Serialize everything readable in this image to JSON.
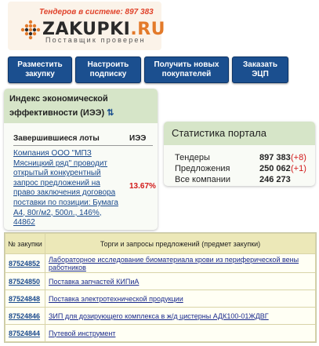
{
  "header": {
    "tenders_line": "Тендеров в системе: 897 383",
    "logo_main": "ZAKUPKI",
    "logo_tld": ".RU",
    "tagline": "Поставщик проверен"
  },
  "nav": {
    "btn1_line1": "Разместить",
    "btn1_line2": "закупку",
    "btn2_line1": "Настроить",
    "btn2_line2": "подписку",
    "btn3_line1": "Получить новых",
    "btn3_line2": "покупателей",
    "btn4_line1": "Заказать",
    "btn4_line2": "ЭЦП"
  },
  "iee": {
    "title": "Индекс экономической эффективности (ИЭЭ)",
    "col_lots": "Завершившиеся лоты",
    "col_iee": "ИЭЭ",
    "lot_text": "Компания ООО \"МПЗ Мясницкий ряд\" проводит открытый конкурентный запрос предложений на право заключения договора поставки по позиции: Бумага А4, 80г/м2, 500л., 146%, 44862",
    "lot_value": "13.67%"
  },
  "stats": {
    "title": "Статистика портала",
    "tenders_label": "Тендеры",
    "tenders_value": "897 383",
    "tenders_delta": "(+8)",
    "offers_label": "Предложения",
    "offers_value": "250 062",
    "offers_delta": "(+1)",
    "companies_label": "Все компании",
    "companies_value": "246 273"
  },
  "table": {
    "col_num": "№ закупки",
    "col_subject": "Торги и запросы предложений (предмет закупки)",
    "rows": [
      {
        "num": "87524852",
        "subject": "Лабораторное исследование биоматериала крови из периферической вены работников"
      },
      {
        "num": "87524850",
        "subject": "Поставка запчастей КИПиА"
      },
      {
        "num": "87524848",
        "subject": "Поставка электротехнической продукции"
      },
      {
        "num": "87524846",
        "subject": "ЗИП для дозирующего комплекса в ж/д цистерны АДК100-01ЖДВГ"
      },
      {
        "num": "87524844",
        "subject": "Путевой инструмент"
      }
    ]
  },
  "colors": {
    "nav_blue": "#1b4f8f",
    "panel_green": "#d6e5c8",
    "accent_red": "#d21a1a",
    "logo_orange": "#e37a2a"
  }
}
